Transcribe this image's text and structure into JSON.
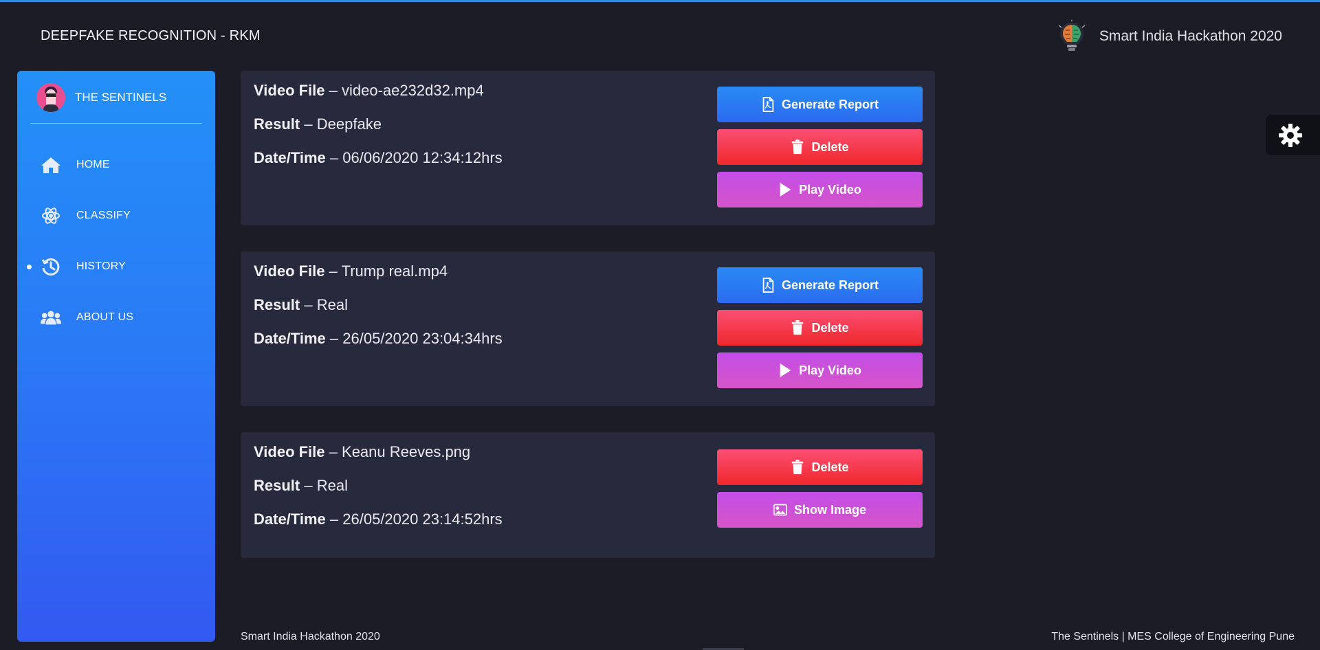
{
  "header": {
    "brand": "DEEPFAKE RECOGNITION - RKM",
    "hackathon_text": "Smart India Hackathon 2020",
    "hackathon_logo_icon": "brain-bulb-icon"
  },
  "sidebar": {
    "profile_name": "THE SENTINELS",
    "items": [
      {
        "label": "HOME",
        "icon": "home-icon",
        "active": false
      },
      {
        "label": "CLASSIFY",
        "icon": "atom-icon",
        "active": false
      },
      {
        "label": "HISTORY",
        "icon": "history-icon",
        "active": true
      },
      {
        "label": "ABOUT US",
        "icon": "users-icon",
        "active": false
      }
    ]
  },
  "labels": {
    "video_file": "Video File",
    "result": "Result",
    "datetime": "Date/Time",
    "separator": "–"
  },
  "records": [
    {
      "file": "video-ae232d32.mp4",
      "result": "Deepfake",
      "datetime": "06/06/2020 12:34:12hrs",
      "buttons": [
        "Generate Report",
        "Delete",
        "Play Video"
      ]
    },
    {
      "file": "Trump real.mp4",
      "result": "Real",
      "datetime": "26/05/2020 23:04:34hrs",
      "buttons": [
        "Generate Report",
        "Delete",
        "Play Video"
      ]
    },
    {
      "file": "Keanu Reeves.png",
      "result": "Real",
      "datetime": "26/05/2020 23:14:52hrs",
      "buttons": [
        "Delete",
        "Show Image"
      ]
    }
  ],
  "footer": {
    "left": "Smart India Hackathon 2020",
    "right": "The Sentinels | MES College of Engineering Pune"
  },
  "colors": {
    "background": "#1b1c26",
    "card": "#272a3c",
    "sidebar_top": "#2390f7",
    "sidebar_bottom": "#3359f0",
    "btn_blue": "#2b7df2",
    "btn_red": "#f5364a",
    "btn_purple": "#cc51d8"
  }
}
